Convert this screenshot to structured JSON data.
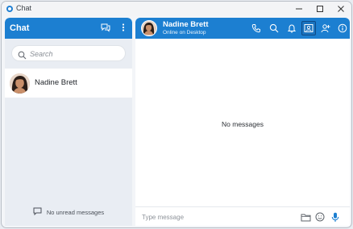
{
  "window": {
    "title": "Chat"
  },
  "sidebar": {
    "title": "Chat",
    "search": {
      "placeholder": "Search",
      "value": ""
    },
    "contacts": [
      {
        "name": "Nadine Brett"
      }
    ],
    "footer_text": "No unread messages"
  },
  "conversation": {
    "contact_name": "Nadine Brett",
    "contact_status": "Online on Desktop",
    "empty_text": "No messages",
    "composer": {
      "placeholder": "Type message",
      "value": ""
    }
  },
  "colors": {
    "accent": "#1c7fd1",
    "selected_icon_border": "#0f4a86"
  },
  "icons": [
    "chat-bubbles-icon",
    "more-vertical-icon",
    "search-icon",
    "phone-icon",
    "bell-icon",
    "contact-card-icon",
    "add-user-icon",
    "info-icon",
    "folder-icon",
    "emoji-icon",
    "microphone-icon",
    "message-icon"
  ]
}
